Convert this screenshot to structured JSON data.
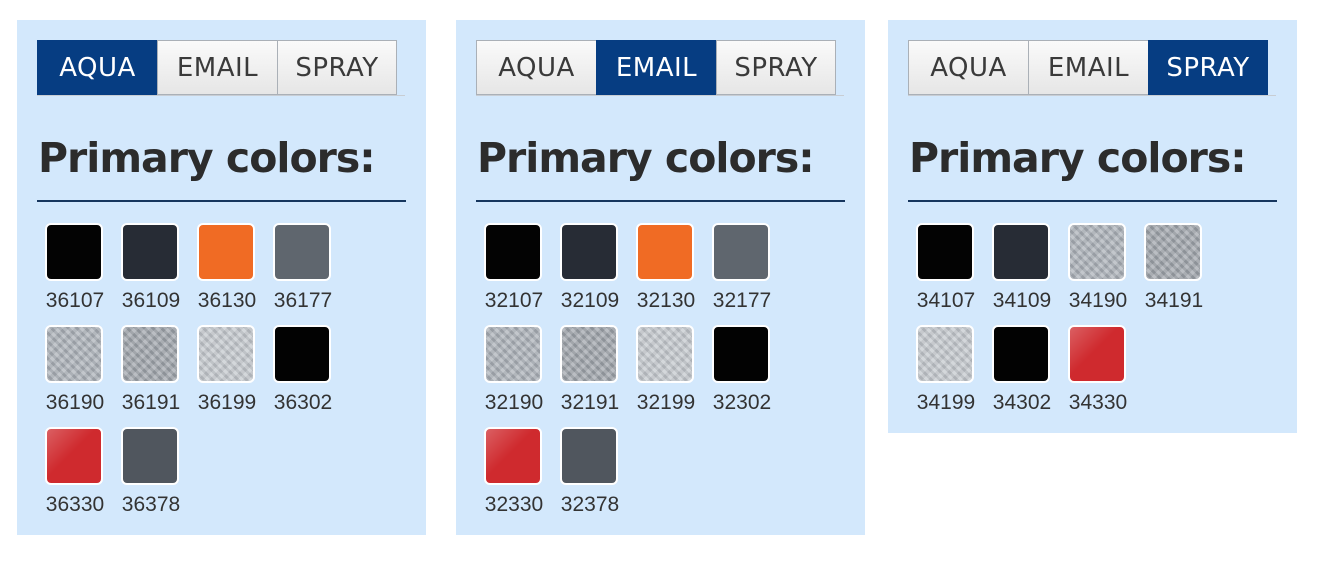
{
  "tabs": [
    "AQUA",
    "EMAIL",
    "SPRAY"
  ],
  "colors": {
    "active_tab": "#063d82",
    "panel_bg": "#d3e8fc",
    "rule": "#16365e"
  },
  "panels": [
    {
      "active_tab": "AQUA",
      "title": "Primary colors:",
      "swatches": [
        {
          "code": "36107",
          "color": "#030303",
          "finish": "solid"
        },
        {
          "code": "36109",
          "color": "#272c35",
          "finish": "solid"
        },
        {
          "code": "36130",
          "color": "#f06b24",
          "finish": "solid"
        },
        {
          "code": "36177",
          "color": "#5f666e",
          "finish": "solid"
        },
        {
          "code": "36190",
          "color": "#aab0b7",
          "finish": "metallic"
        },
        {
          "code": "36191",
          "color": "#9ea3aa",
          "finish": "metallic"
        },
        {
          "code": "36199",
          "color": "#c3c7cc",
          "finish": "metallic"
        },
        {
          "code": "36302",
          "color": "#020202",
          "finish": "solid"
        },
        {
          "code": "36330",
          "color": "#cf2a2e",
          "finish": "gloss"
        },
        {
          "code": "36378",
          "color": "#50565e",
          "finish": "solid"
        }
      ]
    },
    {
      "active_tab": "EMAIL",
      "title": "Primary colors:",
      "swatches": [
        {
          "code": "32107",
          "color": "#030303",
          "finish": "solid"
        },
        {
          "code": "32109",
          "color": "#272c35",
          "finish": "solid"
        },
        {
          "code": "32130",
          "color": "#f06b24",
          "finish": "solid"
        },
        {
          "code": "32177",
          "color": "#5f666e",
          "finish": "solid"
        },
        {
          "code": "32190",
          "color": "#aab0b7",
          "finish": "metallic"
        },
        {
          "code": "32191",
          "color": "#9ea3aa",
          "finish": "metallic"
        },
        {
          "code": "32199",
          "color": "#c3c7cc",
          "finish": "metallic"
        },
        {
          "code": "32302",
          "color": "#020202",
          "finish": "solid"
        },
        {
          "code": "32330",
          "color": "#cf2a2e",
          "finish": "gloss"
        },
        {
          "code": "32378",
          "color": "#50565e",
          "finish": "solid"
        }
      ]
    },
    {
      "active_tab": "SPRAY",
      "title": "Primary colors:",
      "swatches": [
        {
          "code": "34107",
          "color": "#030303",
          "finish": "solid"
        },
        {
          "code": "34109",
          "color": "#272c35",
          "finish": "solid"
        },
        {
          "code": "34190",
          "color": "#aab0b7",
          "finish": "metallic"
        },
        {
          "code": "34191",
          "color": "#9ea3aa",
          "finish": "metallic"
        },
        {
          "code": "34199",
          "color": "#c3c7cc",
          "finish": "metallic"
        },
        {
          "code": "34302",
          "color": "#020202",
          "finish": "solid"
        },
        {
          "code": "34330",
          "color": "#cf2a2e",
          "finish": "gloss"
        }
      ]
    }
  ]
}
